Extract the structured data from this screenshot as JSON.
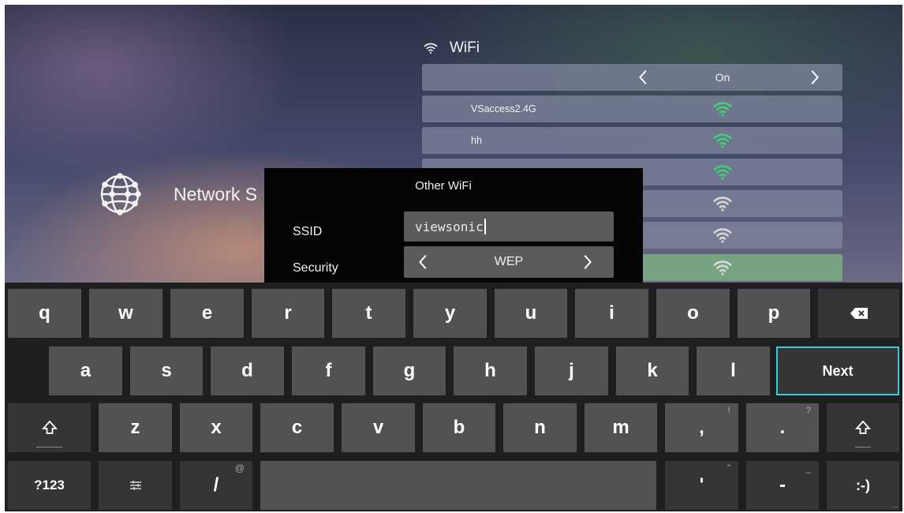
{
  "wifi": {
    "title": "WiFi",
    "toggle_value": "On",
    "networks": [
      {
        "name": "VSaccess2.4G",
        "signal_color": "#3fce7a"
      },
      {
        "name": "hh",
        "signal_color": "#3fce7a"
      },
      {
        "name": "",
        "signal_color": "#3fce7a"
      },
      {
        "name": "",
        "signal_color": "#d8d8d8"
      },
      {
        "name": "",
        "signal_color": "#d8d8d8"
      },
      {
        "name": "",
        "signal_color": "#d8d8d8"
      }
    ]
  },
  "network_settings": {
    "label": "Network S",
    "icon": "globe-icon"
  },
  "dialog": {
    "title": "Other WiFi",
    "ssid_label": "SSID",
    "ssid_value": "viewsonic",
    "security_label": "Security",
    "security_value": "WEP"
  },
  "keyboard": {
    "row1": [
      "q",
      "w",
      "e",
      "r",
      "t",
      "y",
      "u",
      "i",
      "o",
      "p"
    ],
    "row2": [
      "a",
      "s",
      "d",
      "f",
      "g",
      "h",
      "j",
      "k",
      "l"
    ],
    "row3": [
      "z",
      "x",
      "c",
      "v",
      "b",
      "n",
      "m"
    ],
    "next_label": "Next",
    "comma": ",",
    "comma_hint": "!",
    "period": ".",
    "period_hint": "?",
    "symbols_label": "?123",
    "slash": "/",
    "slash_hint": "@",
    "apostrophe": "'",
    "apostrophe_hint": "\"",
    "dash": "-",
    "dash_hint": "_",
    "emoji_label": ":-)",
    "emoji_more": "..."
  },
  "colors": {
    "accent": "#3fc6d8",
    "signal_green": "#3fce7a",
    "selected_row": "#78aa82"
  }
}
